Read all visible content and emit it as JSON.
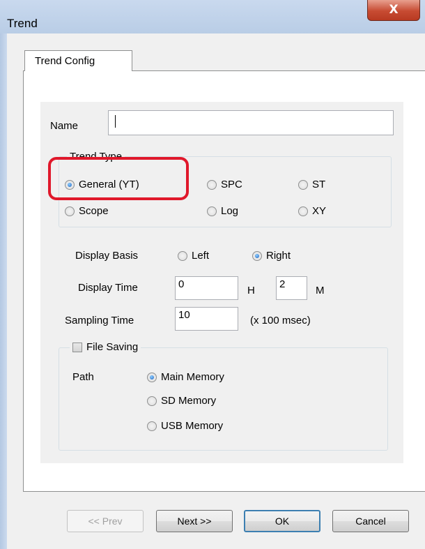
{
  "window": {
    "title": "Trend",
    "close_label": "X"
  },
  "tabs": [
    {
      "label": "Trend Config"
    }
  ],
  "name_field": {
    "label": "Name",
    "value": ""
  },
  "trend_type": {
    "legend": "Trend Type",
    "options": [
      {
        "label": "General (YT)",
        "selected": true
      },
      {
        "label": "SPC",
        "selected": false
      },
      {
        "label": "ST",
        "selected": false
      },
      {
        "label": "Scope",
        "selected": false
      },
      {
        "label": "Log",
        "selected": false
      },
      {
        "label": "XY",
        "selected": false
      }
    ]
  },
  "display_basis": {
    "label": "Display Basis",
    "options": [
      {
        "label": "Left",
        "selected": false
      },
      {
        "label": "Right",
        "selected": true
      }
    ]
  },
  "display_time": {
    "label": "Display Time",
    "hours": "0",
    "hours_unit": "H",
    "minutes": "2",
    "minutes_unit": "M"
  },
  "sampling_time": {
    "label": "Sampling Time",
    "value": "10",
    "unit": "(x 100 msec)"
  },
  "file_saving": {
    "label": "File Saving",
    "checked": false,
    "path_label": "Path",
    "options": [
      {
        "label": "Main Memory",
        "selected": true
      },
      {
        "label": "SD Memory",
        "selected": false
      },
      {
        "label": "USB Memory",
        "selected": false
      }
    ]
  },
  "buttons": {
    "prev": "<< Prev",
    "next": "Next >>",
    "ok": "OK",
    "cancel": "Cancel"
  },
  "colors": {
    "highlight": "#e0182b",
    "accent": "#1c5fbf"
  }
}
